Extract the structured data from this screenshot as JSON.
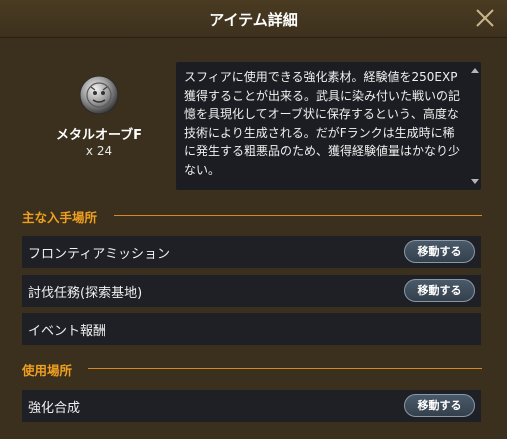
{
  "dialog": {
    "title": "アイテム詳細",
    "close_icon": "close-icon"
  },
  "item": {
    "name": "メタルオーブF",
    "count": "x 24",
    "icon": "metal-orb-icon",
    "description": "スフィアに使用できる強化素材。経験値を250EXP獲得することが出来る。武具に染み付いた戦いの記憶を具現化してオーブ状に保存するという、高度な技術により生成される。だがFランクは生成時に稀に発生する粗悪品のため、獲得経験値量はかなり少ない。"
  },
  "sections": {
    "acquire": {
      "title": "主な入手場所",
      "rows": [
        {
          "label": "フロンティアミッション",
          "button": "移動する"
        },
        {
          "label": "討伐任務(探索基地)",
          "button": "移動する"
        },
        {
          "label": "イベント報酬"
        }
      ]
    },
    "usage": {
      "title": "使用場所",
      "rows": [
        {
          "label": "強化合成",
          "button": "移動する"
        }
      ]
    }
  },
  "colors": {
    "accent": "#f0a020",
    "background": "#3b301d",
    "row": "#1f2025"
  }
}
